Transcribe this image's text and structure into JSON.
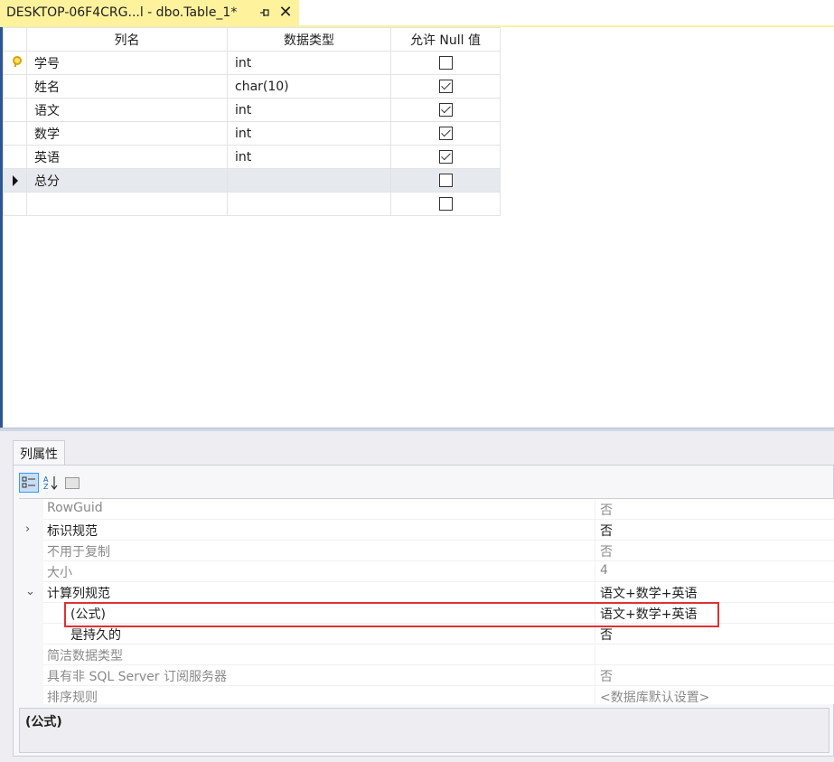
{
  "document_tab": {
    "title": "DESKTOP-06F4CRG...l - dbo.Table_1*",
    "pin_glyph": "⊣",
    "close_glyph": "✕"
  },
  "grid": {
    "headers": [
      "列名",
      "数据类型",
      "允许 Null 值"
    ],
    "rows": [
      {
        "name": "学号",
        "type": "int",
        "allow_null": false,
        "primary_key": true
      },
      {
        "name": "姓名",
        "type": "char(10)",
        "allow_null": true
      },
      {
        "name": "语文",
        "type": "int",
        "allow_null": true
      },
      {
        "name": "数学",
        "type": "int",
        "allow_null": true
      },
      {
        "name": "英语",
        "type": "int",
        "allow_null": true
      },
      {
        "name": "总分",
        "type": "",
        "allow_null": false,
        "current": true
      },
      {
        "name": "",
        "type": "",
        "allow_null": false
      }
    ]
  },
  "properties": {
    "tab_label": "列属性",
    "rows": [
      {
        "name": "RowGuid",
        "value": "否",
        "readonly": true
      },
      {
        "name": "标识规范",
        "value": "否",
        "expander": "›"
      },
      {
        "name": "不用于复制",
        "value": "否",
        "readonly": true
      },
      {
        "name": "大小",
        "value": "4",
        "readonly": true
      },
      {
        "name": "计算列规范",
        "value": "语文+数学+英语",
        "expander": "⌄"
      },
      {
        "name": "(公式)",
        "value": "语文+数学+英语",
        "child": true
      },
      {
        "name": "是持久的",
        "value": "否",
        "child": true
      },
      {
        "name": "简洁数据类型",
        "value": "",
        "readonly": true
      },
      {
        "name": "具有非 SQL Server 订阅服务器",
        "value": "否",
        "readonly": true
      },
      {
        "name": "排序规则",
        "value": "<数据库默认设置>",
        "readonly": true
      }
    ],
    "description_title": "(公式)"
  },
  "colors": {
    "tab_active": "#fff29d",
    "highlight_border": "#e03232",
    "frame_blue": "#2b5797"
  }
}
